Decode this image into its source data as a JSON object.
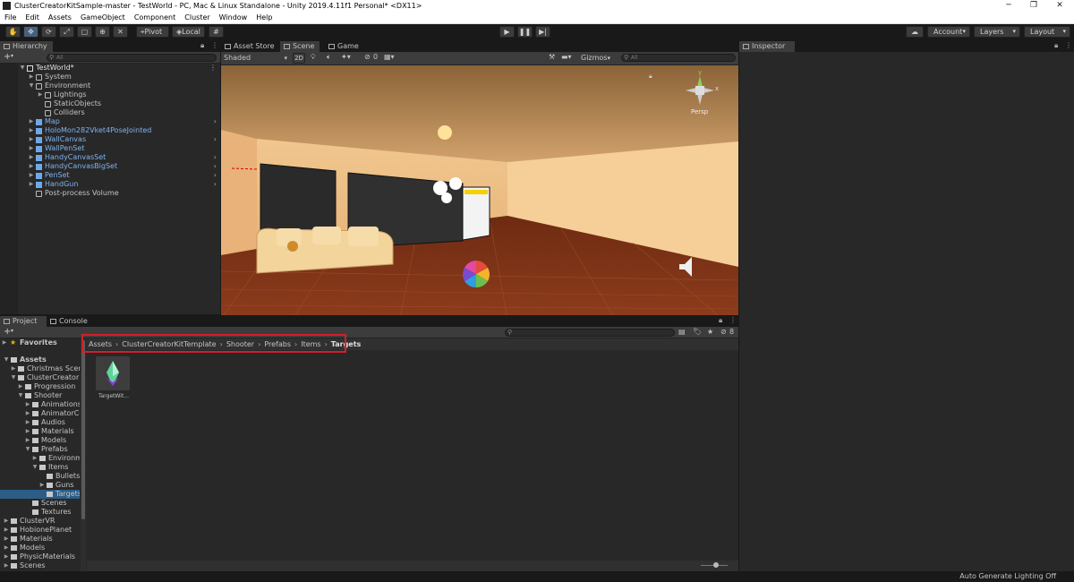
{
  "window": {
    "title": "ClusterCreatorKitSample-master - TestWorld - PC, Mac & Linux Standalone - Unity 2019.4.11f1 Personal* <DX11>",
    "controls": [
      "─",
      "❐",
      "✕"
    ]
  },
  "menu": [
    "File",
    "Edit",
    "Assets",
    "GameObject",
    "Component",
    "Cluster",
    "Window",
    "Help"
  ],
  "toolbar": {
    "pivot_label": "Pivot",
    "local_label": "Local",
    "account_label": "Account",
    "layers_label": "Layers",
    "layout_label": "Layout"
  },
  "hierarchy": {
    "tab": "Hierarchy",
    "search_placeholder": "All",
    "items": [
      {
        "label": "TestWorld*",
        "depth": 0,
        "type": "scene",
        "arrow": "▼",
        "menu": true
      },
      {
        "label": "System",
        "depth": 1,
        "type": "go",
        "arrow": "▶"
      },
      {
        "label": "Environment",
        "depth": 1,
        "type": "go",
        "arrow": "▼"
      },
      {
        "label": "Lightings",
        "depth": 2,
        "type": "go",
        "arrow": "▶"
      },
      {
        "label": "StaticObjects",
        "depth": 2,
        "type": "go",
        "arrow": ""
      },
      {
        "label": "Colliders",
        "depth": 2,
        "type": "go",
        "arrow": ""
      },
      {
        "label": "Map",
        "depth": 1,
        "type": "prefab",
        "arrow": "▶",
        "chev": true
      },
      {
        "label": "HoloMon282Vket4PoseJointed",
        "depth": 1,
        "type": "prefab",
        "arrow": "▶"
      },
      {
        "label": "WallCanvas",
        "depth": 1,
        "type": "prefab",
        "arrow": "▶",
        "chev": true
      },
      {
        "label": "WallPenSet",
        "depth": 1,
        "type": "prefab",
        "arrow": "▶"
      },
      {
        "label": "HandyCanvasSet",
        "depth": 1,
        "type": "prefab",
        "arrow": "▶",
        "chev": true
      },
      {
        "label": "HandyCanvasBigSet",
        "depth": 1,
        "type": "prefab",
        "arrow": "▶",
        "chev": true
      },
      {
        "label": "PenSet",
        "depth": 1,
        "type": "prefab",
        "arrow": "▶",
        "chev": true
      },
      {
        "label": "HandGun",
        "depth": 1,
        "type": "prefab",
        "arrow": "▶",
        "chev": true
      },
      {
        "label": "Post-process Volume",
        "depth": 1,
        "type": "go",
        "arrow": ""
      }
    ]
  },
  "scene": {
    "tabs": [
      "Asset Store",
      "Scene",
      "Game"
    ],
    "shading_mode": "Shaded",
    "mode_2d": "2D",
    "hidden_count": "0",
    "gizmos_label": "Gizmos",
    "search_placeholder": "All",
    "persp_label": "Persp",
    "axis_y": "y",
    "axis_x": "x",
    "panel_text": "Off"
  },
  "inspector": {
    "tab": "Inspector"
  },
  "project": {
    "tabs": [
      "Project",
      "Console"
    ],
    "hidden_count": "8",
    "favorites_label": "Favorites",
    "tree": [
      {
        "label": "Assets",
        "depth": 0,
        "arrow": "▼",
        "bold": true
      },
      {
        "label": "Christmas Scene",
        "depth": 1,
        "arrow": "▶"
      },
      {
        "label": "ClusterCreatorKit",
        "depth": 1,
        "arrow": "▼"
      },
      {
        "label": "Progression",
        "depth": 2,
        "arrow": "▶"
      },
      {
        "label": "Shooter",
        "depth": 2,
        "arrow": "▼"
      },
      {
        "label": "Animations",
        "depth": 3,
        "arrow": "▶"
      },
      {
        "label": "AnimatorCo",
        "depth": 3,
        "arrow": "▶"
      },
      {
        "label": "Audios",
        "depth": 3,
        "arrow": "▶"
      },
      {
        "label": "Materials",
        "depth": 3,
        "arrow": "▶"
      },
      {
        "label": "Models",
        "depth": 3,
        "arrow": "▶"
      },
      {
        "label": "Prefabs",
        "depth": 3,
        "arrow": "▼"
      },
      {
        "label": "Environm",
        "depth": 4,
        "arrow": "▶"
      },
      {
        "label": "Items",
        "depth": 4,
        "arrow": "▼"
      },
      {
        "label": "Bullets",
        "depth": 5,
        "arrow": ""
      },
      {
        "label": "Guns",
        "depth": 5,
        "arrow": "▶"
      },
      {
        "label": "Targets",
        "depth": 5,
        "arrow": "",
        "selected": true
      },
      {
        "label": "Scenes",
        "depth": 3,
        "arrow": ""
      },
      {
        "label": "Textures",
        "depth": 3,
        "arrow": ""
      },
      {
        "label": "ClusterVR",
        "depth": 0,
        "arrow": "▶"
      },
      {
        "label": "HobionePlanet",
        "depth": 0,
        "arrow": "▶"
      },
      {
        "label": "Materials",
        "depth": 0,
        "arrow": "▶"
      },
      {
        "label": "Models",
        "depth": 0,
        "arrow": "▶"
      },
      {
        "label": "PhysicMaterials",
        "depth": 0,
        "arrow": "▶"
      },
      {
        "label": "Scenes",
        "depth": 0,
        "arrow": "▶"
      }
    ],
    "breadcrumb": [
      "Assets",
      "ClusterCreatorKitTemplate",
      "Shooter",
      "Prefabs",
      "Items",
      "Targets"
    ],
    "assets": [
      {
        "label": "TargetWit...",
        "icon": "prefab-crystal-icon"
      }
    ]
  },
  "status": {
    "right_text": "Auto Generate Lighting Off"
  },
  "colors": {
    "selection": "#2c5d87",
    "prefab_text": "#7fb2f0",
    "highlight_box": "#d2202b"
  }
}
